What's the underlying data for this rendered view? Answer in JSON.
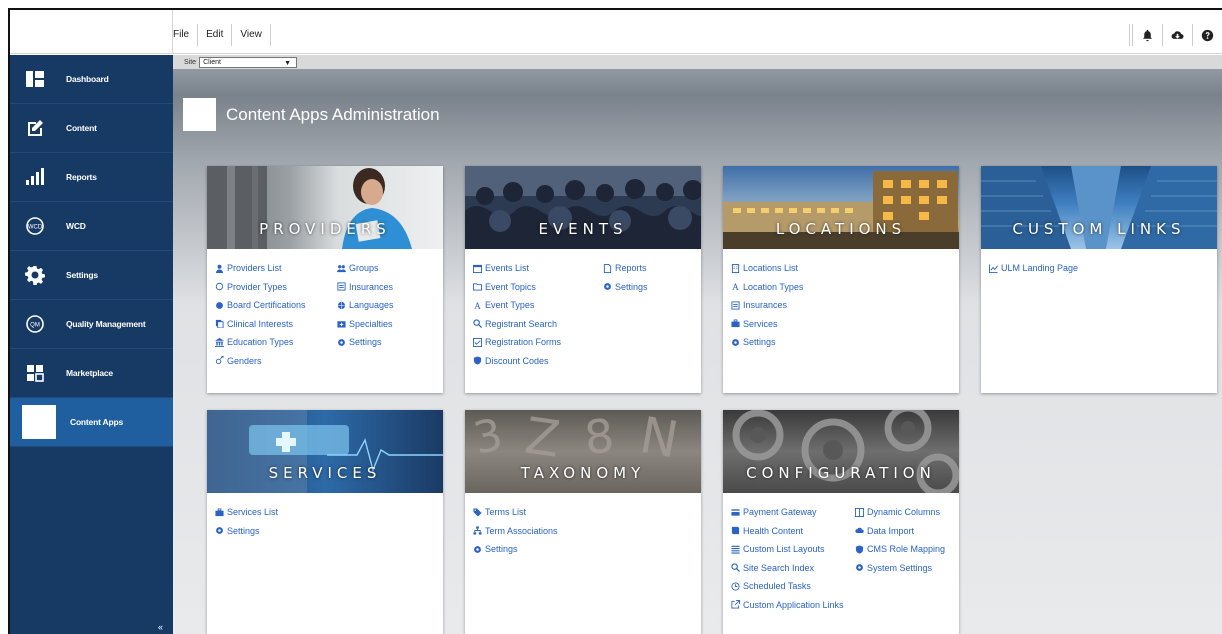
{
  "menu": {
    "items": [
      "File",
      "Edit",
      "View"
    ]
  },
  "top_icons": [
    "bell-icon",
    "cloud-download-icon",
    "help-icon"
  ],
  "sidebar": {
    "items": [
      {
        "label": "Dashboard",
        "icon": "dashboard-icon"
      },
      {
        "label": "Content",
        "icon": "edit-icon"
      },
      {
        "label": "Reports",
        "icon": "bar-chart-icon"
      },
      {
        "label": "WCD",
        "icon": "wcd-icon"
      },
      {
        "label": "Settings",
        "icon": "gear-icon"
      },
      {
        "label": "Quality Management",
        "icon": "qm-icon"
      },
      {
        "label": "Marketplace",
        "icon": "marketplace-icon"
      },
      {
        "label": "Content Apps",
        "icon": "content-apps-icon"
      }
    ],
    "active_index": 7,
    "collapse": "«"
  },
  "site": {
    "label": "Site",
    "value": "Client",
    "arrow": "▼"
  },
  "page": {
    "title": "Content Apps Administration"
  },
  "cards": {
    "providers": {
      "title": "PROVIDERS",
      "col1": [
        "Providers List",
        "Provider Types",
        "Board Certifications",
        "Clinical Interests",
        "Education Types",
        "Genders"
      ],
      "col2": [
        "Groups",
        "Insurances",
        "Languages",
        "Specialties",
        "Settings"
      ]
    },
    "events": {
      "title": "EVENTS",
      "col1": [
        "Events List",
        "Event Topics",
        "Event Types",
        "Registrant Search",
        "Registration Forms",
        "Discount Codes"
      ],
      "col2": [
        "Reports",
        "Settings"
      ]
    },
    "locations": {
      "title": "LOCATIONS",
      "col1": [
        "Locations List",
        "Location Types",
        "Insurances",
        "Services",
        "Settings"
      ]
    },
    "custom_links": {
      "title": "CUSTOM LINKS",
      "col1": [
        "ULM Landing Page"
      ]
    },
    "services": {
      "title": "SERVICES",
      "col1": [
        "Services List",
        "Settings"
      ]
    },
    "taxonomy": {
      "title": "TAXONOMY",
      "col1": [
        "Terms List",
        "Term Associations",
        "Settings"
      ]
    },
    "configuration": {
      "title": "CONFIGURATION",
      "col1": [
        "Payment Gateway",
        "Health Content",
        "Custom List Layouts",
        "Site Search Index",
        "Scheduled Tasks",
        "Custom Application Links"
      ],
      "col2": [
        "Dynamic Columns",
        "Data Import",
        "CMS Role Mapping",
        "System Settings"
      ]
    }
  },
  "colors": {
    "sidebar": "#163a64",
    "sidebar_active": "#1f5f9f",
    "link": "#2a63c4"
  }
}
